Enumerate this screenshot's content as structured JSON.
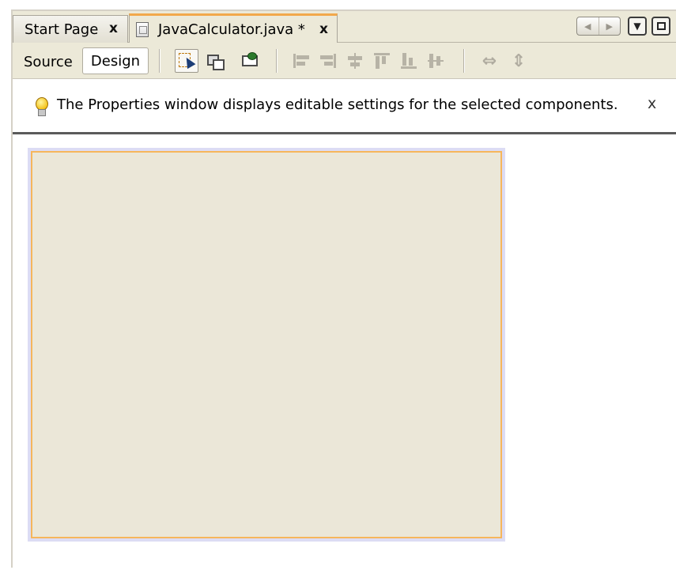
{
  "tabs": [
    {
      "label": "Start Page",
      "close": "x",
      "active": false
    },
    {
      "label": "JavaCalculator.java *",
      "close": "x",
      "active": true
    }
  ],
  "window_controls": {
    "nav_left": "◀",
    "nav_right": "▶",
    "dropdown": "▼"
  },
  "toolbar": {
    "source_label": "Source",
    "design_label": "Design",
    "tools": [
      "selection-mode-icon",
      "connection-mode-icon",
      "preview-design-icon",
      "align-left-icon",
      "align-right-icon",
      "center-horizontally-icon",
      "align-top-icon",
      "align-bottom-icon",
      "center-vertically-icon",
      "change-horizontal-resizability-icon",
      "change-vertical-resizability-icon"
    ]
  },
  "hint": {
    "text": "The Properties window displays editable settings for the selected components.",
    "close": "x",
    "icon": "lightbulb-icon"
  },
  "colors": {
    "chrome": "#ece9d8",
    "active_tab_accent": "#f2a84b",
    "form_background": "#ebe7d8",
    "form_border": "#f6b65c",
    "form_outline": "#dcdcf4"
  }
}
